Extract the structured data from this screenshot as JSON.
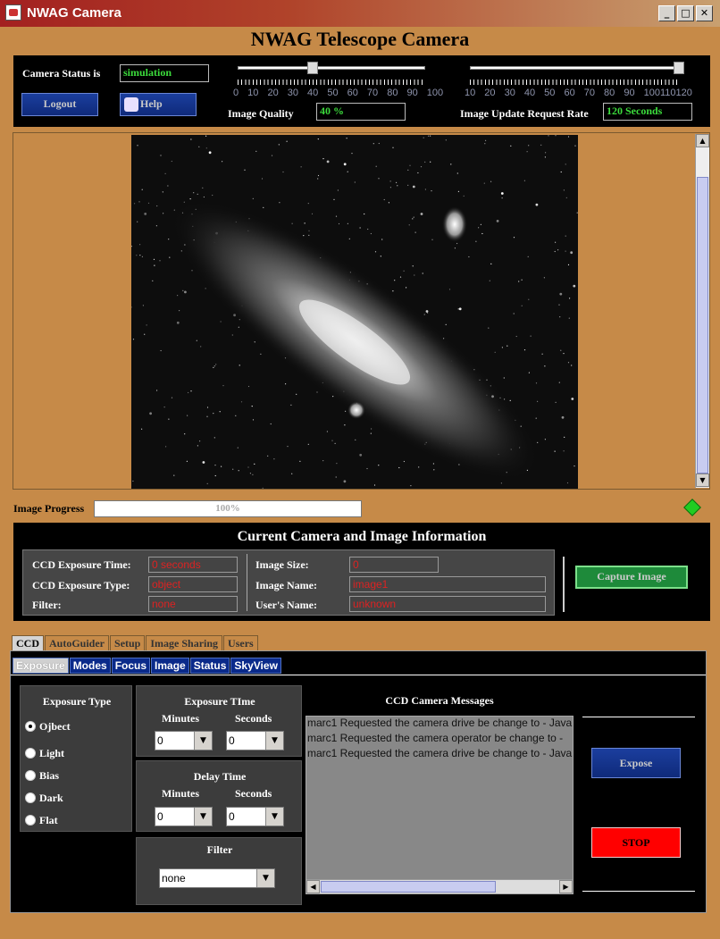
{
  "window": {
    "title": "NWAG Camera"
  },
  "app": {
    "title": "NWAG Telescope Camera"
  },
  "status": {
    "label": "Camera Status is",
    "value": "simulation"
  },
  "buttons": {
    "logout": "Logout",
    "help": "Help",
    "capture": "Capture Image",
    "expose": "Expose",
    "stop": "STOP"
  },
  "quality": {
    "label": "Image Quality",
    "value": "40 %",
    "ticks": "0 10 20 30 40 50 60 70 80 90 100",
    "level_percent": 40
  },
  "update": {
    "label": "Image Update Request Rate",
    "value": "120 Seconds",
    "ticks": "10 20 30 40 50 60 70 80 90 100110120",
    "level_seconds": 120
  },
  "progress": {
    "label": "Image Progress",
    "text": "100%",
    "level_percent": 100
  },
  "info": {
    "title": "Current Camera and Image Information",
    "exposure_time_label": "CCD Exposure Time:",
    "exposure_time": "0 seconds",
    "exposure_type_label": "CCD Exposure Type:",
    "exposure_type": "object",
    "filter_label": "Filter:",
    "filter": "none",
    "image_size_label": "Image Size:",
    "image_size": "0",
    "image_name_label": "Image Name:",
    "image_name": "image1",
    "user_name_label": "User's  Name:",
    "user_name": "unknown"
  },
  "tabs": [
    "CCD",
    "AutoGuider",
    "Setup",
    "Image Sharing",
    "Users"
  ],
  "subtabs": [
    "Exposure",
    "Modes",
    "Focus",
    "Image",
    "Status",
    "SkyView"
  ],
  "exposure_type": {
    "title": "Exposure Type",
    "options": [
      "Ojbect",
      "Light",
      "Bias",
      "Dark",
      "Flat"
    ],
    "selected": "Ojbect"
  },
  "exposure_time": {
    "title": "Exposure TIme",
    "minutes_label": "Minutes",
    "seconds_label": "Seconds",
    "minutes": "0",
    "seconds": "0"
  },
  "delay_time": {
    "title": "Delay Time",
    "minutes_label": "Minutes",
    "seconds_label": "Seconds",
    "minutes": "0",
    "seconds": "0"
  },
  "filter": {
    "title": "Filter",
    "value": "none"
  },
  "messages": {
    "title": "CCD Camera Messages",
    "lines": [
      "marc1 Requested the camera drive be change to - Java",
      "marc1 Requested the camera operator be change to - ",
      "marc1 Requested the camera drive be change to - Java"
    ]
  },
  "colors": {
    "status_green": "#3cdc3c",
    "error_red": "#dd2222",
    "window_bg": "#c68a48"
  }
}
